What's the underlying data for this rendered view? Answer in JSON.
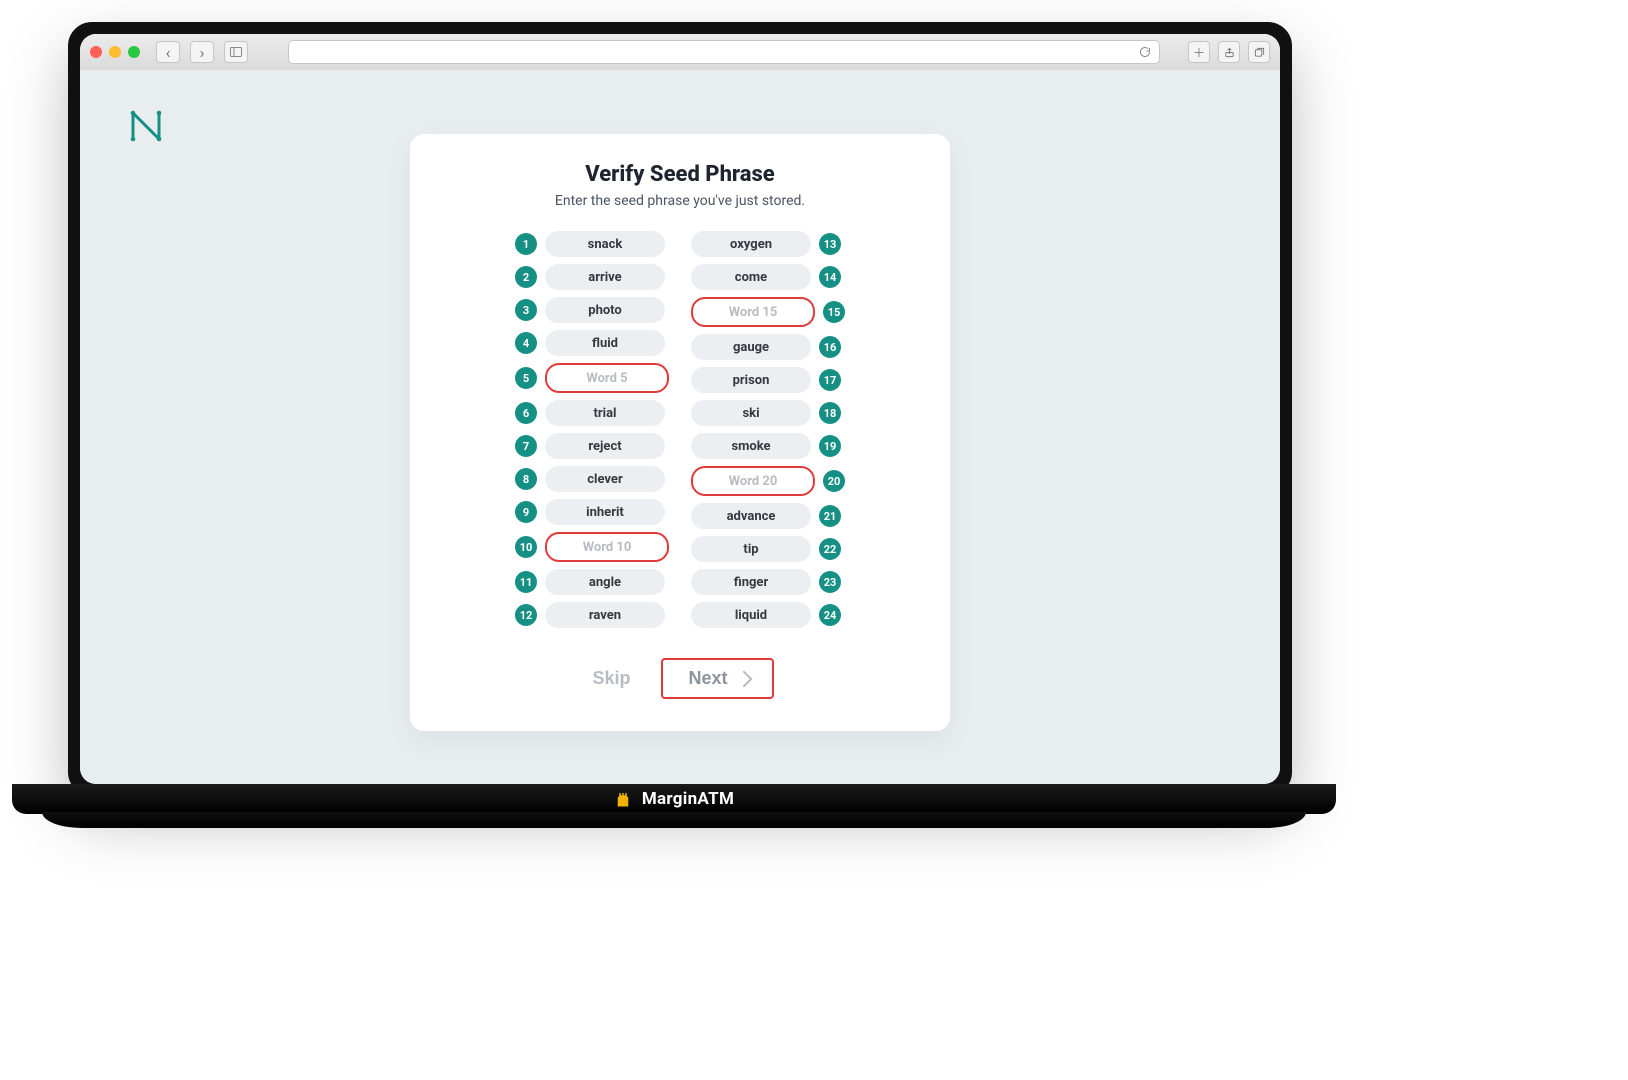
{
  "browser": {
    "back": "‹",
    "forward": "›"
  },
  "bottom_brand": "MarginATM",
  "card": {
    "title": "Verify Seed Phrase",
    "subtitle": "Enter the seed phrase you've just stored.",
    "skip_label": "Skip",
    "next_label": "Next"
  },
  "seed": {
    "left": [
      {
        "n": "1",
        "v": "snack",
        "editable": false
      },
      {
        "n": "2",
        "v": "arrive",
        "editable": false
      },
      {
        "n": "3",
        "v": "photo",
        "editable": false
      },
      {
        "n": "4",
        "v": "fluid",
        "editable": false
      },
      {
        "n": "5",
        "v": "Word 5",
        "editable": true
      },
      {
        "n": "6",
        "v": "trial",
        "editable": false
      },
      {
        "n": "7",
        "v": "reject",
        "editable": false
      },
      {
        "n": "8",
        "v": "clever",
        "editable": false
      },
      {
        "n": "9",
        "v": "inherit",
        "editable": false
      },
      {
        "n": "10",
        "v": "Word 10",
        "editable": true
      },
      {
        "n": "11",
        "v": "angle",
        "editable": false
      },
      {
        "n": "12",
        "v": "raven",
        "editable": false
      }
    ],
    "right": [
      {
        "n": "13",
        "v": "oxygen",
        "editable": false
      },
      {
        "n": "14",
        "v": "come",
        "editable": false
      },
      {
        "n": "15",
        "v": "Word 15",
        "editable": true
      },
      {
        "n": "16",
        "v": "gauge",
        "editable": false
      },
      {
        "n": "17",
        "v": "prison",
        "editable": false
      },
      {
        "n": "18",
        "v": "ski",
        "editable": false
      },
      {
        "n": "19",
        "v": "smoke",
        "editable": false
      },
      {
        "n": "20",
        "v": "Word 20",
        "editable": true
      },
      {
        "n": "21",
        "v": "advance",
        "editable": false
      },
      {
        "n": "22",
        "v": "tip",
        "editable": false
      },
      {
        "n": "23",
        "v": "finger",
        "editable": false
      },
      {
        "n": "24",
        "v": "liquid",
        "editable": false
      }
    ]
  }
}
